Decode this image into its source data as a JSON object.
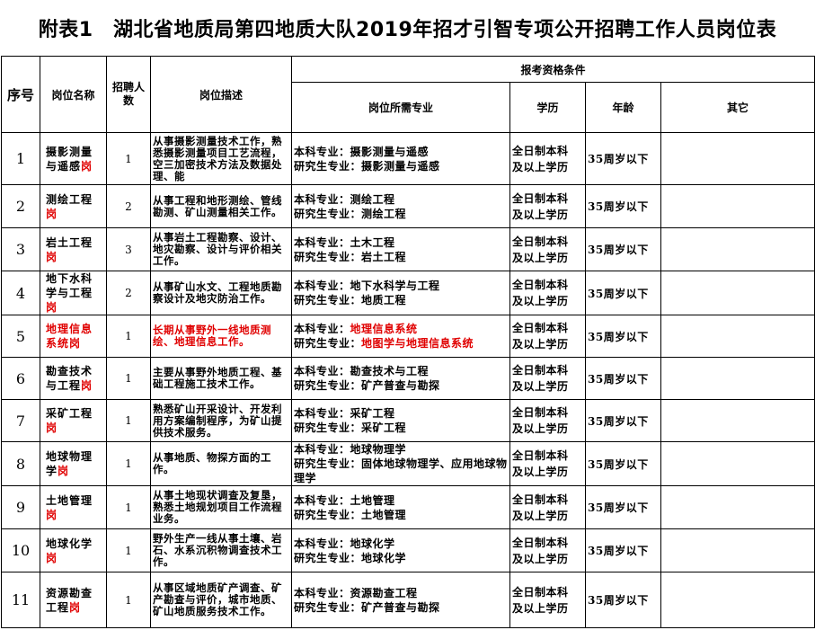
{
  "title": "附表1　湖北省地质局第四地质大队2019年招才引智专项公开招聘工作人员岗位表",
  "headers": {
    "seq": "序号",
    "name": "岗位名称",
    "count": "招聘人数",
    "desc": "岗位描述",
    "qual": "报考资格条件",
    "major": "岗位所需专业",
    "edu": "学历",
    "age": "年龄",
    "other": "其它"
  },
  "rows": [
    {
      "seq": "1",
      "name_a": "摄影测量",
      "name_b": "与遥感",
      "suffix": "岗",
      "count": "1",
      "desc": "从事摄影测量技术工作，熟悉摄影测量项目工艺流程，空三加密技术方法及数据处理、能",
      "major_a": "本科专业：摄影测量与遥感",
      "major_b": "研究生专业：摄影测量与遥感",
      "edu_a": "全日制本科",
      "edu_b": "及以上学历",
      "age": "35周岁以下",
      "highlight": false
    },
    {
      "seq": "2",
      "name_a": "测绘工程",
      "name_b": "",
      "suffix": "岗",
      "count": "2",
      "desc": "从事工程和地形测绘、管线勘测、矿山测量相关工作。",
      "major_a": "本科专业：测绘工程",
      "major_b": "研究生专业：测绘工程",
      "edu_a": "全日制本科",
      "edu_b": "及以上学历",
      "age": "35周岁以下",
      "highlight": false
    },
    {
      "seq": "3",
      "name_a": "岩土工程",
      "name_b": "",
      "suffix": "岗",
      "count": "3",
      "desc": "从事岩土工程勘察、设计、地灾勘察、设计与评价相关工作。",
      "major_a": "本科专业：土木工程",
      "major_b": "研究生专业：岩土工程",
      "edu_a": "全日制本科",
      "edu_b": "及以上学历",
      "age": "35周岁以下",
      "highlight": false
    },
    {
      "seq": "4",
      "name_a": "地下水科",
      "name_b": "学与工程",
      "suffix": "岗",
      "count": "2",
      "desc": "从事矿山水文、工程地质勘察设计及地灾防治工作。",
      "major_a": "本科专业：地下水科学与工程",
      "major_b": "研究生专业：地质工程",
      "edu_a": "全日制本科",
      "edu_b": "及以上学历",
      "age": "35周岁以下",
      "highlight": false
    },
    {
      "seq": "5",
      "name_a": "地理信息",
      "name_b": "系统",
      "suffix": "岗",
      "count": "1",
      "desc": "长期从事野外一线地质测绘、地理信息工作。",
      "major_a": "本科专业：地理信息系统",
      "major_b": "研究生专业：地图学与地理信息系统",
      "edu_a": "全日制本科",
      "edu_b": "及以上学历",
      "age": "35周岁以下",
      "highlight": true
    },
    {
      "seq": "6",
      "name_a": "勘查技术",
      "name_b": "与工程",
      "suffix": "岗",
      "count": "1",
      "desc": "主要从事野外地质工程、基础工程施工技术工作。",
      "major_a": "本科专业：勘查技术与工程",
      "major_b": "研究生专业：矿产普查与勘探",
      "edu_a": "全日制本科",
      "edu_b": "及以上学历",
      "age": "35周岁以下",
      "highlight": false
    },
    {
      "seq": "7",
      "name_a": "采矿工程",
      "name_b": "",
      "suffix": "岗",
      "count": "1",
      "desc": "熟悉矿山开采设计、开发利用方案编制程序，为矿山提供技术服务。",
      "major_a": "本科专业：采矿工程",
      "major_b": "研究生专业：采矿工程",
      "edu_a": "全日制本科",
      "edu_b": "及以上学历",
      "age": "35周岁以下",
      "highlight": false
    },
    {
      "seq": "8",
      "name_a": "地球物理",
      "name_b": "学",
      "suffix": "岗",
      "count": "1",
      "desc": "从事地质、物探方面的工作。",
      "major_a": "本科专业：地球物理学",
      "major_b": "研究生专业：固体地球物理学、应用地球物理学",
      "edu_a": "全日制本科",
      "edu_b": "及以上学历",
      "age": "35周岁以下",
      "highlight": false
    },
    {
      "seq": "9",
      "name_a": "土地管理",
      "name_b": "",
      "suffix": "岗",
      "count": "1",
      "desc": "从事土地现状调查及复垦，熟悉土地规划项目工作流程业务。",
      "major_a": "本科专业：土地管理",
      "major_b": "研究生专业：土地管理",
      "edu_a": "全日制本科",
      "edu_b": "及以上学历",
      "age": "35周岁以下",
      "highlight": false
    },
    {
      "seq": "10",
      "name_a": "地球化学",
      "name_b": "",
      "suffix": "岗",
      "count": "1",
      "desc": "野外生产一线从事土壤、岩石、水系沉积物调查技术工作。",
      "major_a": "本科专业：地球化学",
      "major_b": "研究生专业：地球化学",
      "edu_a": "全日制本科",
      "edu_b": "及以上学历",
      "age": "35周岁以下",
      "highlight": false
    },
    {
      "seq": "11",
      "name_a": "资源勘查",
      "name_b": "工程",
      "suffix": "岗",
      "count": "1",
      "desc": "从事区域地质矿产调查、矿产勘查与评价，城市地质、矿山地质服务技术工作。",
      "major_a": "本科专业：资源勘查工程",
      "major_b": "研究生专业：矿产普查与勘探",
      "edu_a": "全日制本科",
      "edu_b": "及以上学历",
      "age": "35周岁以下",
      "highlight": false
    }
  ],
  "colors": {
    "highlight": "#e00000",
    "border": "#000000",
    "text": "#000000"
  }
}
